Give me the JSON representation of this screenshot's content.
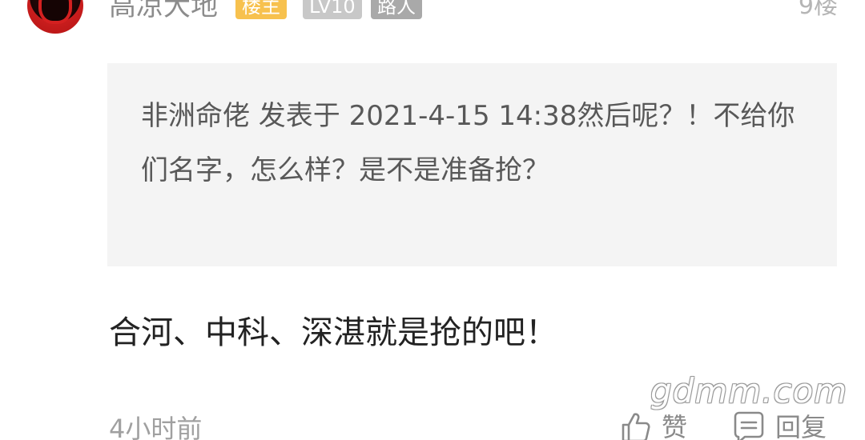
{
  "post": {
    "author": {
      "name": "高凉大地",
      "badges": [
        "楼主",
        "LV10",
        "路人"
      ]
    },
    "floor": "9楼",
    "quote": {
      "text": "非洲命佬 发表于 2021-4-15 14:38然后呢？！不给你们名字，怎么样？是不是准备抢？"
    },
    "content": "合河、中科、深湛就是抢的吧！",
    "time": "4小时前",
    "actions": {
      "like_label": "赞",
      "reply_label": "回复"
    }
  },
  "watermark": "gdmm.com",
  "colors": {
    "owner_badge": "#f7c14e",
    "level_badge": "#c8c8c8",
    "title_badge": "#a9a9a9",
    "quote_background": "#f4f4f4",
    "avatar_red": "#c91d1d"
  },
  "icons": {
    "like": "thumbs-up-icon",
    "reply": "comment-icon"
  }
}
